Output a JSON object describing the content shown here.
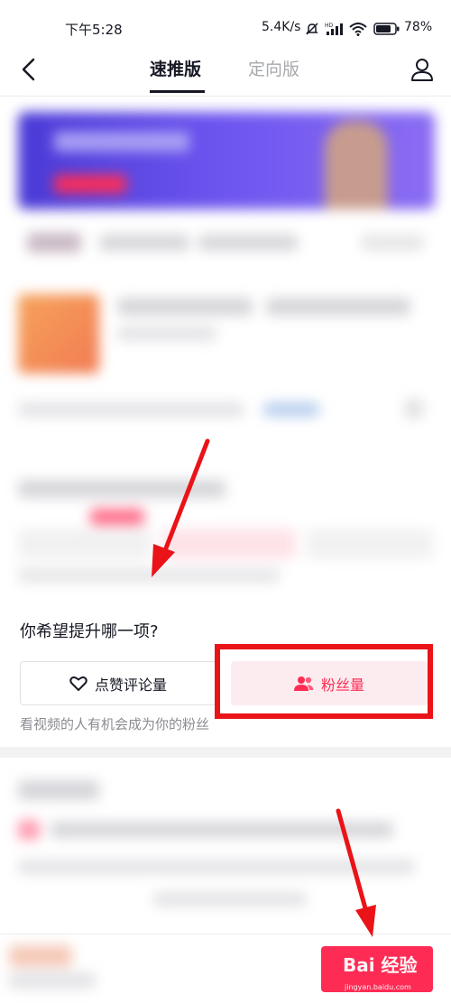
{
  "status_bar": {
    "time": "下午5:28",
    "network_speed": "5.4K/s",
    "battery_percent": "78%"
  },
  "nav": {
    "back_icon": "chevron-left-icon",
    "tabs": [
      {
        "label": "速推版",
        "active": true
      },
      {
        "label": "定向版",
        "active": false
      }
    ],
    "profile_icon": "user-icon"
  },
  "goal_section": {
    "question": "你希望提升哪一项?",
    "options": [
      {
        "label": "点赞评论量",
        "icon": "heart-icon",
        "selected": false
      },
      {
        "label": "粉丝量",
        "icon": "users-icon",
        "selected": true
      }
    ],
    "hint": "看视频的人有机会成为你的粉丝"
  },
  "watermark": {
    "text": "Bai 经验",
    "sub": "jingyan.baidu.com"
  },
  "colors": {
    "accent": "#fe2c55",
    "annotation_red": "#ea1318",
    "selected_bg": "#fdecef",
    "banner": "#5b47e0"
  }
}
